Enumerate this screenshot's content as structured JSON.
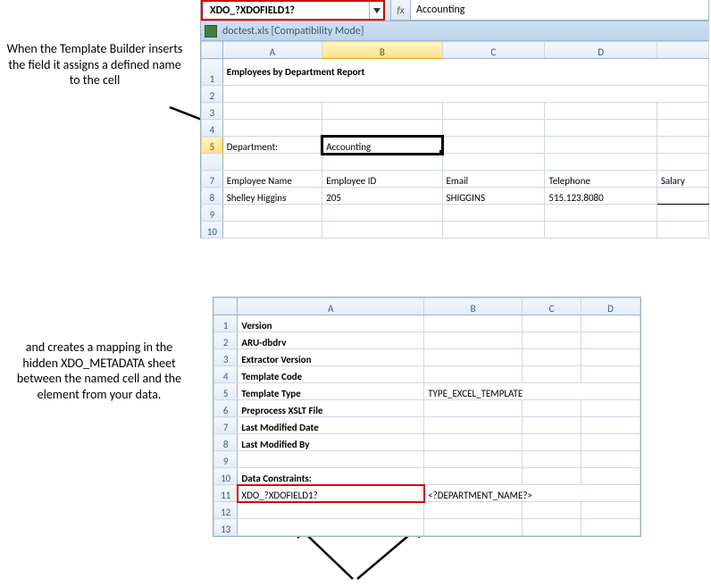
{
  "annotations": {
    "top": "When the Template Builder inserts the field it assigns a defined name to the cell",
    "bottom": "and creates a mapping in the hidden XDO_METADATA sheet between the named cell and the element from your data."
  },
  "top_sheet": {
    "name_box": "XDO_?XDOFIELD1?",
    "fx_label": "fx",
    "formula_bar": "Accounting",
    "file_title": "doctest.xls  [Compatibility Mode]",
    "columns": [
      "A",
      "B",
      "C",
      "D",
      ""
    ],
    "active_col": "B",
    "active_row": 5,
    "row_labels": [
      "1",
      "2",
      "3",
      "4",
      "5",
      "",
      "7",
      "8",
      "9",
      "10"
    ],
    "title": "Employees by Department Report",
    "department_label": "Department:",
    "department_value": "Accounting",
    "headers": {
      "emp_name": "Employee Name",
      "emp_id": "Employee ID",
      "email": "Email",
      "telephone": "Telephone",
      "salary": "Salary"
    },
    "row8": {
      "emp_name": "Shelley Higgins",
      "emp_id": "205",
      "email": "SHIGGINS",
      "telephone": "515.123.8080"
    }
  },
  "metadata_sheet": {
    "columns": [
      "A",
      "B",
      "C",
      "D"
    ],
    "row_labels": [
      "1",
      "2",
      "3",
      "4",
      "5",
      "6",
      "7",
      "8",
      "9",
      "10",
      "11",
      "12",
      "13"
    ],
    "rows": {
      "r1a": "Version",
      "r2a": "ARU-dbdrv",
      "r3a": "Extractor Version",
      "r4a": "Template Code",
      "r5a": "Template Type",
      "r5b": "TYPE_EXCEL_TEMPLATE",
      "r6a": "Preprocess XSLT File",
      "r7a": "Last Modified Date",
      "r8a": "Last Modified By",
      "r10a": "Data Constraints:",
      "r11a": "XDO_?XDOFIELD1?",
      "r11b": "<?DEPARTMENT_NAME?>"
    }
  }
}
